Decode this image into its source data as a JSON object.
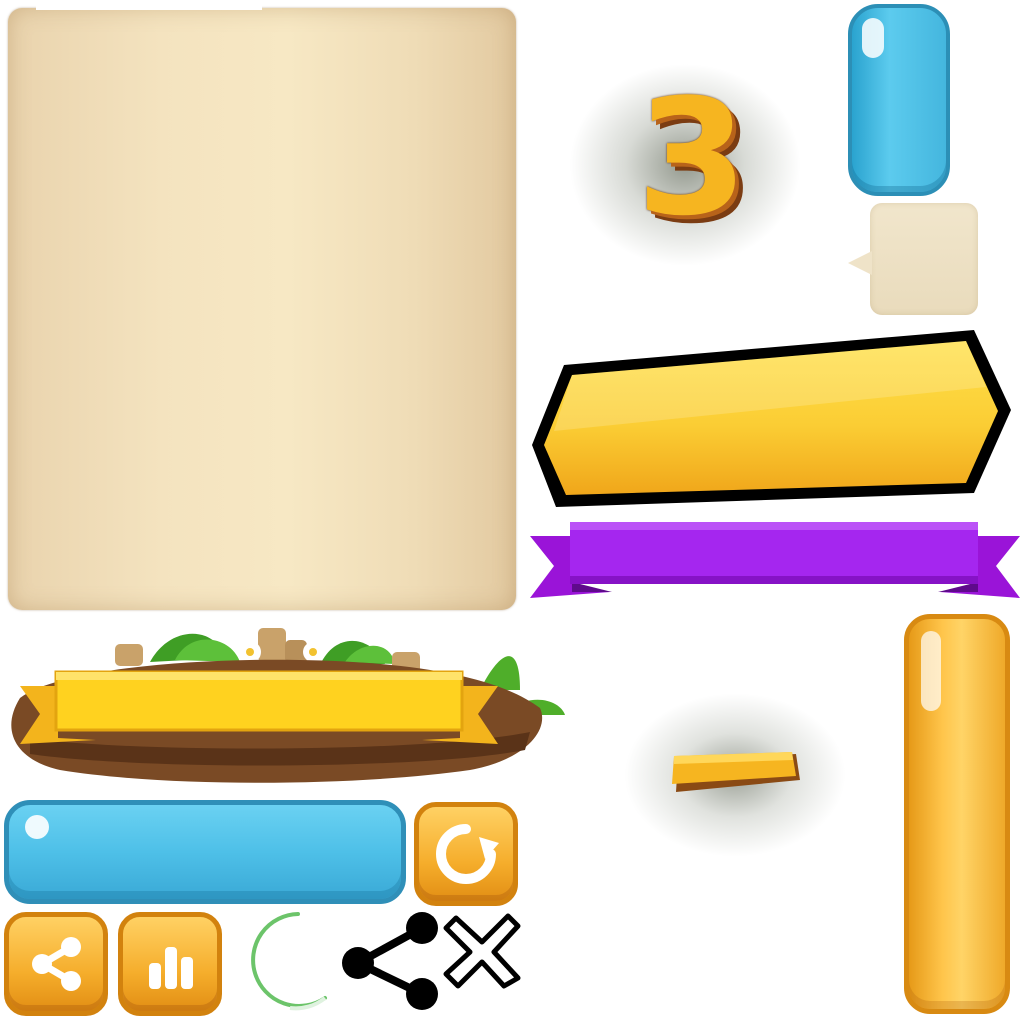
{
  "sprites": {
    "number_display": "3",
    "parchment_panel": "parchment",
    "blue_vertical_button": "blue-pill",
    "speech_bubble": "speech-bubble",
    "yellow_banner": "yellow-banner",
    "purple_ribbon": "purple-ribbon",
    "jungle_sign": "jungle-sign",
    "minus": "minus-sign",
    "orange_vertical_button": "orange-pill",
    "wide_blue_button": "wide-blue-button",
    "restart_icon": "restart-icon",
    "share_icon": "share-icon",
    "stats_icon": "bar-chart-icon",
    "loading_indicator": "loading-ring",
    "share_icon_black": "share-icon",
    "close_icon": "close-icon"
  },
  "colors": {
    "parchment": "#f4e3bf",
    "blue": "#4ec0e8",
    "orange": "#f5ad2b",
    "yellow": "#f7c32b",
    "purple": "#a020f0",
    "wood": "#7a4a25",
    "leaf": "#4fae2a",
    "ring_green": "#6cc46a"
  }
}
